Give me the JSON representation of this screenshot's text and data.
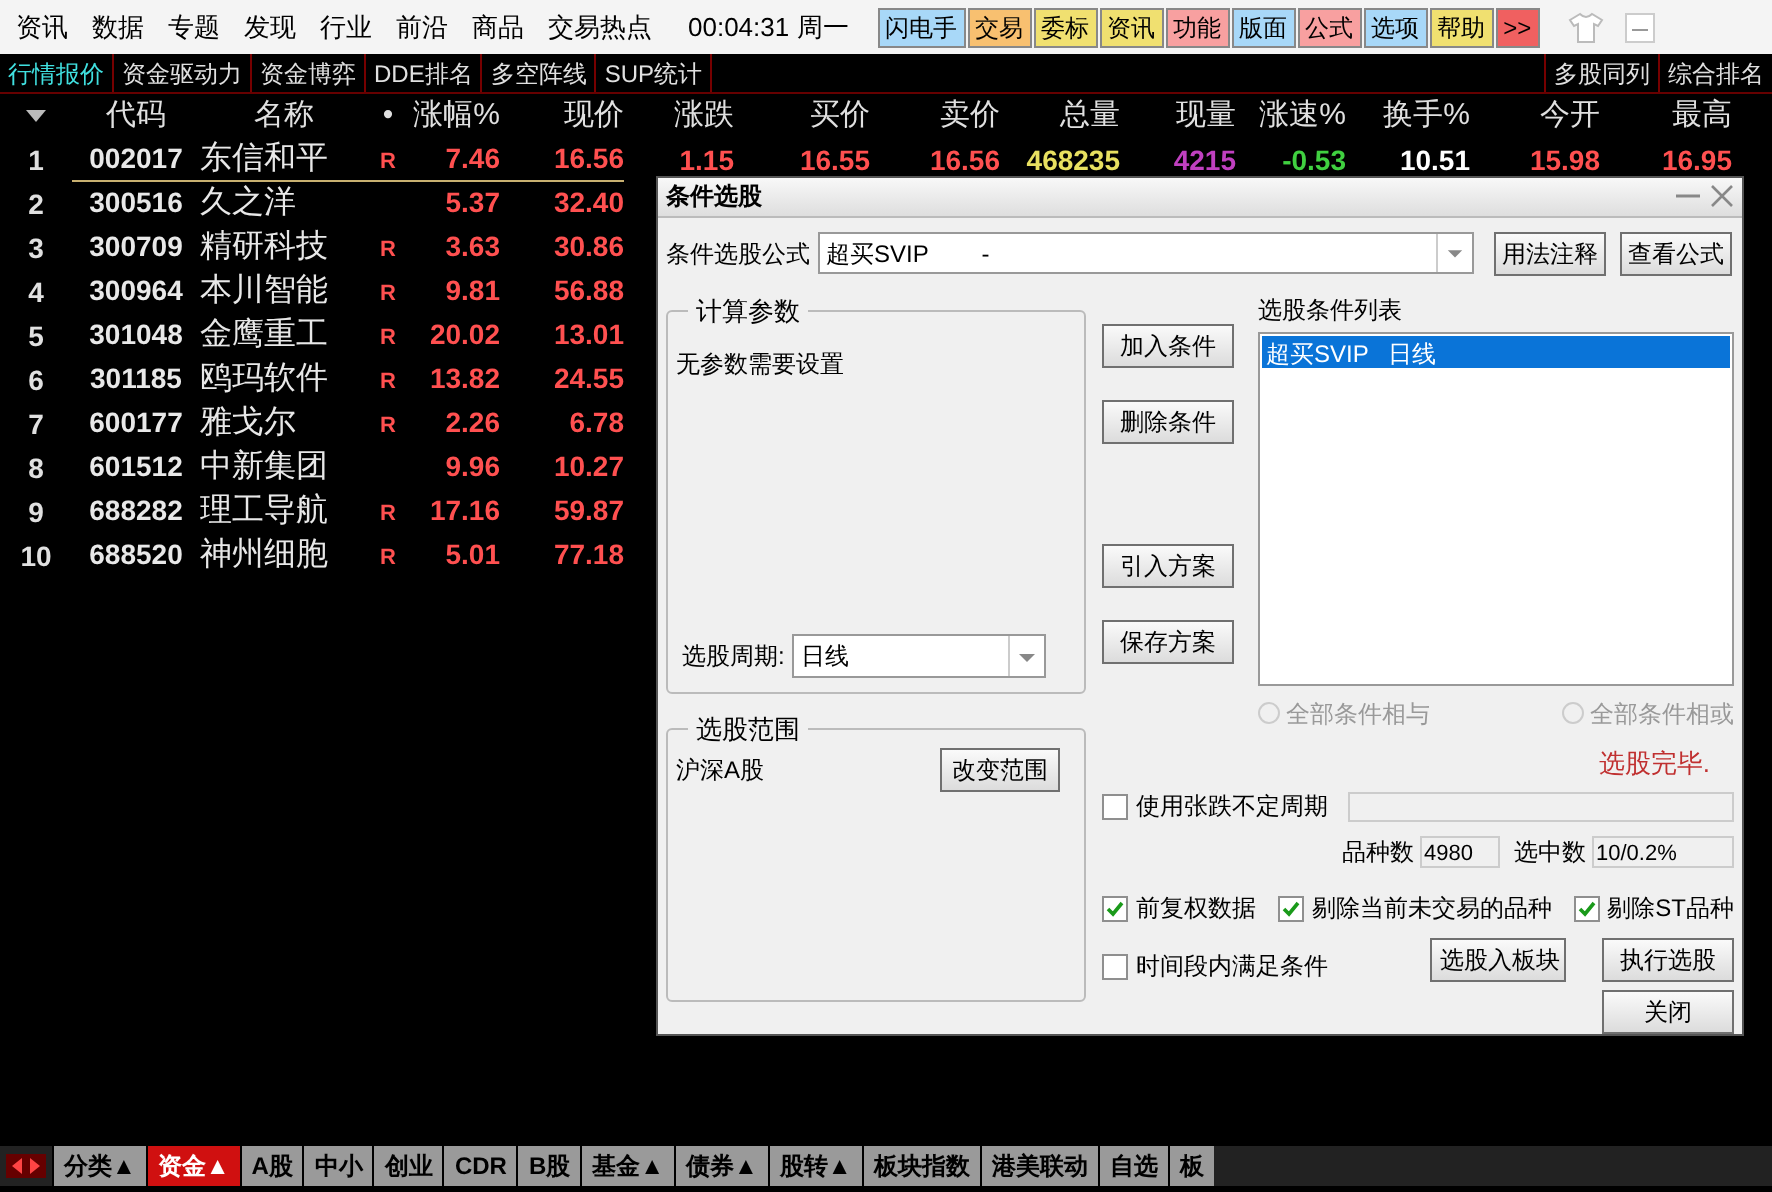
{
  "menu_bar": {
    "items": [
      "资讯",
      "数据",
      "专题",
      "发现",
      "行业",
      "前沿",
      "商品",
      "交易热点"
    ],
    "clock": "00:04:31",
    "weekday": "周一",
    "quick_buttons": [
      {
        "label": "闪电手",
        "color": "#a8d8f8"
      },
      {
        "label": "交易",
        "color": "#f8c070"
      },
      {
        "label": "委标",
        "color": "#f0e070"
      },
      {
        "label": "资讯",
        "color": "#f0e070"
      },
      {
        "label": "功能",
        "color": "#f8a0a0"
      },
      {
        "label": "版面",
        "color": "#a8d8f8"
      },
      {
        "label": "公式",
        "color": "#f8a0a0"
      },
      {
        "label": "选项",
        "color": "#a8d8f8"
      },
      {
        "label": "帮助",
        "color": "#f0e070"
      },
      {
        "label": ">>",
        "color": "#f06060"
      }
    ]
  },
  "view_tabs": [
    {
      "label": "行情报价",
      "selected": true
    },
    {
      "label": "资金驱动力",
      "selected": false
    },
    {
      "label": "资金博弈",
      "selected": false
    },
    {
      "label": "DDE排名",
      "selected": false
    },
    {
      "label": "多空阵线",
      "selected": false
    },
    {
      "label": "SUP统计",
      "selected": false
    }
  ],
  "right_tabs": [
    "多股同列",
    "综合排名"
  ],
  "table": {
    "columns": [
      "代码",
      "名称",
      "•",
      "涨幅%",
      "现价",
      "涨跌",
      "买价",
      "卖价",
      "总量",
      "现量",
      "涨速%",
      "换手%",
      "今开",
      "最高"
    ],
    "rows": [
      {
        "no": "1",
        "code": "002017",
        "name": "东信和平",
        "flag": "R",
        "change": "7.46",
        "price": "16.56",
        "selected": true,
        "extra": [
          {
            "text": "1.15",
            "color": "#ff5050"
          },
          {
            "text": "16.55",
            "color": "#ff5050"
          },
          {
            "text": "16.56",
            "color": "#ff5050"
          },
          {
            "text": "468235",
            "color": "#e8e060"
          },
          {
            "text": "4215",
            "color": "#c040c0"
          },
          {
            "text": "-0.53",
            "color": "#40d040"
          },
          {
            "text": "10.51",
            "color": "#ffffff"
          },
          {
            "text": "15.98",
            "color": "#ff5050"
          },
          {
            "text": "16.95",
            "color": "#ff5050"
          }
        ]
      },
      {
        "no": "2",
        "code": "300516",
        "name": "久之洋",
        "change": "5.37",
        "price": "32.40",
        "selected": false
      },
      {
        "no": "3",
        "code": "300709",
        "name": "精研科技",
        "flag": "R",
        "change": "3.63",
        "price": "30.86",
        "selected": false
      },
      {
        "no": "4",
        "code": "300964",
        "name": "本川智能",
        "flag": "R",
        "change": "9.81",
        "price": "56.88",
        "selected": false
      },
      {
        "no": "5",
        "code": "301048",
        "name": "金鹰重工",
        "flag": "R",
        "change": "20.02",
        "price": "13.01",
        "selected": false
      },
      {
        "no": "6",
        "code": "301185",
        "name": "鸥玛软件",
        "flag": "R",
        "change": "13.82",
        "price": "24.55",
        "selected": false
      },
      {
        "no": "7",
        "code": "600177",
        "name": "雅戈尔",
        "flag": "R",
        "change": "2.26",
        "price": "6.78",
        "selected": false
      },
      {
        "no": "8",
        "code": "601512",
        "name": "中新集团",
        "change": "9.96",
        "price": "10.27",
        "selected": false
      },
      {
        "no": "9",
        "code": "688282",
        "name": "理工导航",
        "flag": "R",
        "change": "17.16",
        "price": "59.87",
        "selected": false
      },
      {
        "no": "10",
        "code": "688520",
        "name": "神州细胞",
        "flag": "R",
        "change": "5.01",
        "price": "77.18",
        "selected": false
      }
    ]
  },
  "dialog": {
    "title": "条件选股",
    "formula_label": "条件选股公式",
    "formula_value": "超买SVIP        -",
    "help_button": "用法注释",
    "view_button": "查看公式",
    "params_group": "计算参数",
    "params_text": "无参数需要设置",
    "period_label": "选股周期:",
    "period_value": "日线",
    "scope_group": "选股范围",
    "scope_text": "沪深A股",
    "scope_button": "改变范围",
    "middle_buttons": [
      "加入条件",
      "删除条件",
      "引入方案",
      "保存方案"
    ],
    "list_label": "选股条件列表",
    "list_items": [
      {
        "text": "超买SVIP   日线",
        "selected": true
      }
    ],
    "radios": [
      {
        "label": "全部条件相与",
        "selected": false,
        "disabled": true
      },
      {
        "label": "全部条件相或",
        "selected": false,
        "disabled": true
      }
    ],
    "status": "选股完毕.",
    "variable_period": {
      "label": "使用张跌不定周期",
      "checked": false
    },
    "count_label": "品种数",
    "count_value": "4980",
    "selected_label": "选中数",
    "selected_value": "10/0.2%",
    "options": [
      {
        "label": "前复权数据",
        "checked": true
      },
      {
        "label": "剔除当前未交易的品种",
        "checked": true
      },
      {
        "label": "剔除ST品种",
        "checked": true
      }
    ],
    "time_range": {
      "label": "时间段内满足条件",
      "checked": false
    },
    "buttons": [
      "选股入板块",
      "执行选股",
      "关闭"
    ]
  },
  "bottom_tabs": [
    {
      "label": "分类▲",
      "selected": false
    },
    {
      "label": "资金▲",
      "selected": true
    },
    {
      "label": "A股",
      "selected": false
    },
    {
      "label": "中小",
      "selected": false
    },
    {
      "label": "创业",
      "selected": false
    },
    {
      "label": "CDR",
      "selected": false
    },
    {
      "label": "B股",
      "selected": false
    },
    {
      "label": "基金▲",
      "selected": false
    },
    {
      "label": "债券▲",
      "selected": false
    },
    {
      "label": "股转▲",
      "selected": false
    },
    {
      "label": "板块指数",
      "selected": false
    },
    {
      "label": "港美联动",
      "selected": false
    },
    {
      "label": "自选",
      "selected": false
    },
    {
      "label": "板",
      "selected": false
    }
  ]
}
